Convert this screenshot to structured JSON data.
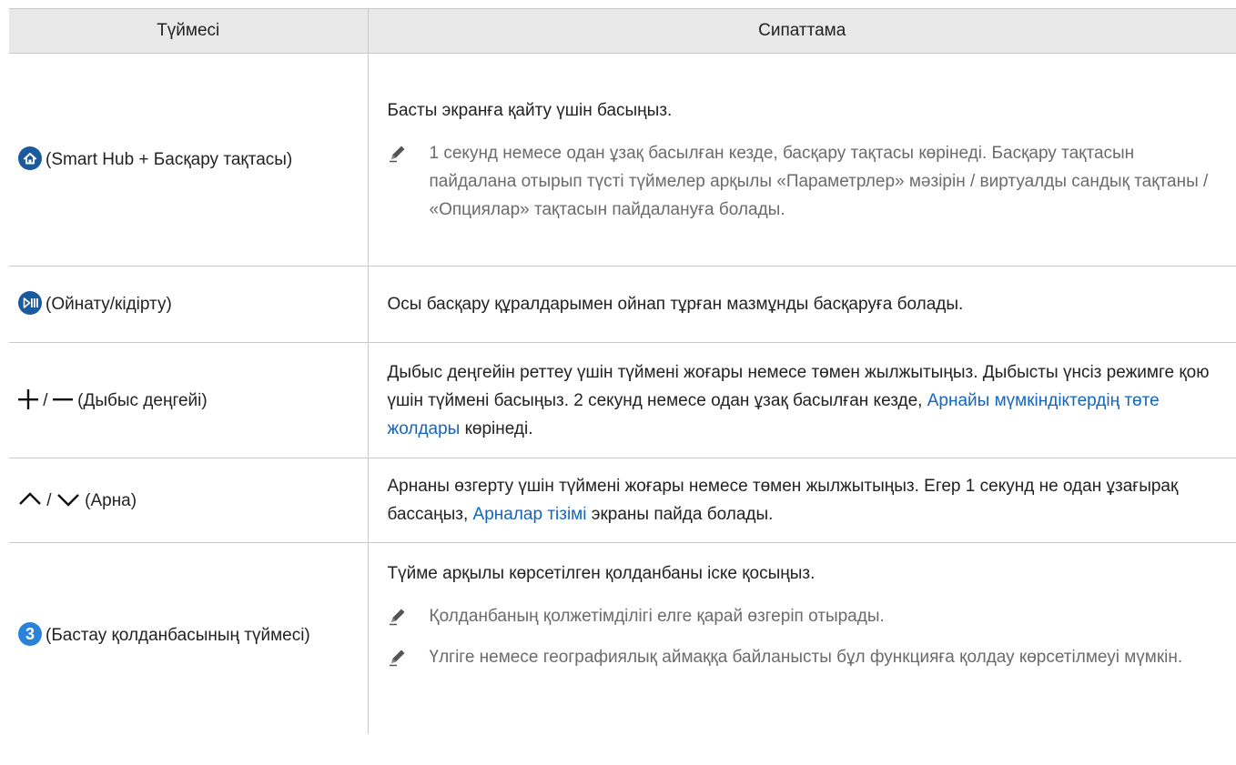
{
  "header": {
    "col_key": "Түймесі",
    "col_desc": "Сипаттама"
  },
  "rows": [
    {
      "key_label": "(Smart Hub + Басқару тақтасы)",
      "icon": "home-icon",
      "desc": "Басты экранға қайту үшін басыңыз.",
      "notes": [
        "1 секунд немесе одан ұзақ басылған кезде, басқару тақтасы көрінеді. Басқару тақтасын пайдалана отырып түсті түймелер арқылы «Параметрлер» мәзірін / виртуалды сандық тақтаны / «Опциялар» тақтасын пайдалануға болады."
      ]
    },
    {
      "key_label": "(Ойнату/кідірту)",
      "icon": "play-pause-icon",
      "desc": "Осы басқару құралдарымен ойнап тұрған мазмұнды басқаруға болады."
    },
    {
      "key_label": "(Дыбыс деңгейі)",
      "icon": "volume-plus-minus-icon",
      "key_sep": "/",
      "desc_a": "Дыбыс деңгейін реттеу үшін түймені жоғары немесе төмен жылжытыңыз. Дыбысты үнсіз режимге қою үшін түймені басыңыз. 2 секунд немесе одан ұзақ басылған кезде,",
      "desc_link": "Арнайы мүмкіндіктердің төте жолдары",
      "desc_b": "көрінеді."
    },
    {
      "key_label": "(Арна)",
      "icon": "channel-up-down-icon",
      "key_sep": "/",
      "desc_a": "Арнаны өзгерту үшін түймені жоғары немесе төмен жылжытыңыз. Егер 1 секунд не одан ұзағырақ бассаңыз,",
      "desc_link": "Арналар тізімі",
      "desc_b": "экраны пайда болады."
    },
    {
      "key_label": "(Бастау қолданбасының түймесі)",
      "icon": "launch-app-icon",
      "badge": "3",
      "desc": "Түйме арқылы көрсетілген қолданбаны іске қосыңыз.",
      "notes": [
        "Қолданбаның қолжетімділігі елге қарай өзгеріп отырады.",
        "Үлгіге немесе географиялық аймаққа байланысты бұл функцияға қолдау көрсетілмеуі мүмкін."
      ]
    }
  ],
  "colors": {
    "header_bg": "#e9e9e9",
    "link": "#1366c0",
    "note_text": "#6b6b6b",
    "icon_dark": "#1a5a9e",
    "icon_light": "#2a83d8"
  }
}
